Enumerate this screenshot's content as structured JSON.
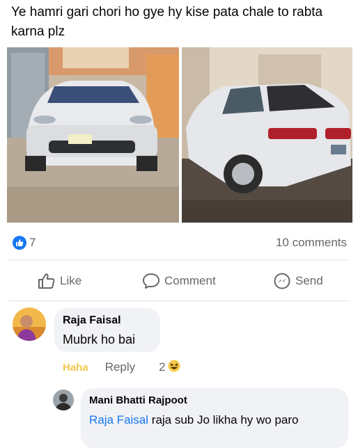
{
  "post": {
    "text": "Ye hamri gari chori ho gye hy kise pata chale to rabta karna plz"
  },
  "stats": {
    "reactions_count": "7",
    "comments_count": "10 comments"
  },
  "actions": {
    "like": "Like",
    "comment": "Comment",
    "send": "Send"
  },
  "comments": [
    {
      "author": "Raja Faisal",
      "text": "Mubrk ho bai",
      "reaction_label": "Haha",
      "reply_label": "Reply",
      "reaction_count": "2"
    },
    {
      "author": "Mani Bhatti Rajpoot",
      "mention": "Raja Faisal",
      "text": "raja sub Jo likha hy wo paro"
    }
  ],
  "colors": {
    "accent": "#1877f2",
    "muted": "#65676b",
    "bubble": "#f0f2f5"
  }
}
